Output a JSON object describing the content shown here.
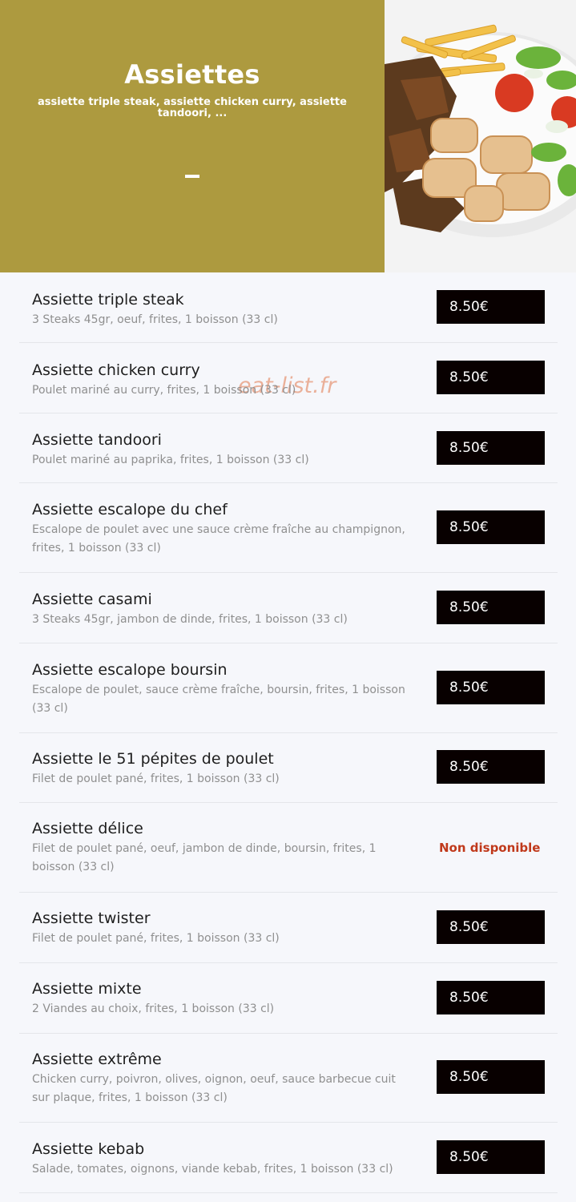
{
  "hero": {
    "title": "Assiettes",
    "subtitle": "assiette triple steak, assiette chicken curry, assiette tandoori, ...",
    "bg_color": "#ad9a3f",
    "image": "plate-of-grilled-meat-chicken-fries-salad"
  },
  "watermark": "eat-list.fr",
  "items": [
    {
      "name": "Assiette triple steak",
      "desc": "3 Steaks 45gr, oeuf, frites, 1 boisson (33 cl)",
      "price": "8.50€"
    },
    {
      "name": "Assiette chicken curry",
      "desc": "Poulet mariné au curry, frites, 1 boisson (33 cl)",
      "price": "8.50€"
    },
    {
      "name": "Assiette tandoori",
      "desc": "Poulet mariné au paprika, frites, 1 boisson (33 cl)",
      "price": "8.50€"
    },
    {
      "name": "Assiette escalope du chef",
      "desc": "Escalope de poulet avec une sauce crème fraîche au champignon, frites, 1 boisson (33 cl)",
      "price": "8.50€"
    },
    {
      "name": "Assiette casami",
      "desc": "3 Steaks 45gr, jambon de dinde, frites, 1 boisson (33 cl)",
      "price": "8.50€"
    },
    {
      "name": "Assiette escalope boursin",
      "desc": "Escalope de poulet, sauce crème fraîche, boursin, frites, 1 boisson (33 cl)",
      "price": "8.50€"
    },
    {
      "name": "Assiette le 51 pépites de poulet",
      "desc": "Filet de poulet pané, frites, 1 boisson (33 cl)",
      "price": "8.50€"
    },
    {
      "name": "Assiette délice",
      "desc": "Filet de poulet pané, oeuf, jambon de dinde, boursin, frites, 1 boisson (33 cl)",
      "unavailable": "Non disponible"
    },
    {
      "name": "Assiette twister",
      "desc": "Filet de poulet pané, frites, 1 boisson (33 cl)",
      "price": "8.50€"
    },
    {
      "name": "Assiette mixte",
      "desc": "2 Viandes au choix, frites, 1 boisson (33 cl)",
      "price": "8.50€"
    },
    {
      "name": "Assiette extrême",
      "desc": "Chicken curry, poivron, olives, oignon, oeuf, sauce barbecue cuit sur plaque, frites, 1 boisson (33 cl)",
      "price": "8.50€"
    },
    {
      "name": "Assiette kebab",
      "desc": "Salade, tomates, oignons, viande kebab, frites, 1 boisson (33 cl)",
      "price": "8.50€"
    }
  ]
}
